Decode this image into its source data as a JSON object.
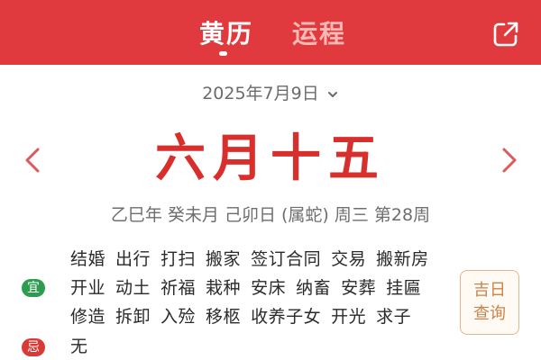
{
  "header": {
    "tabs": [
      {
        "label": "黄历",
        "active": true
      },
      {
        "label": "运程",
        "active": false
      }
    ],
    "share_icon": "share-external-icon",
    "colors": {
      "bar": "#e13a3e",
      "active": "#ffffff",
      "inactive": "#f6b9b6"
    }
  },
  "date": {
    "label": "2025年7月9日"
  },
  "lunar": {
    "label": "六月十五"
  },
  "ganzhi": {
    "text": "乙巳年 癸未月 己卯日 (属蛇) 周三  第28周"
  },
  "yi": {
    "badge": "宜",
    "rows": [
      [
        "结婚",
        "出行",
        "打扫",
        "搬家",
        "签订合同",
        "交易",
        "搬新房"
      ],
      [
        "开业",
        "动土",
        "祈福",
        "栽种",
        "安床",
        "纳畜",
        "安葬",
        "挂匾"
      ],
      [
        "修造",
        "拆卸",
        "入殓",
        "移柩",
        "收养子女",
        "开光",
        "求子"
      ]
    ]
  },
  "ji": {
    "badge": "忌",
    "text": "无"
  },
  "jiri_button": {
    "line1": "吉日",
    "line2": "查询"
  },
  "colors": {
    "lunar": "#d82f2c",
    "yi_badge": "#2e9c4f",
    "ji_badge": "#d83a36",
    "button_border": "#e6b58a"
  }
}
